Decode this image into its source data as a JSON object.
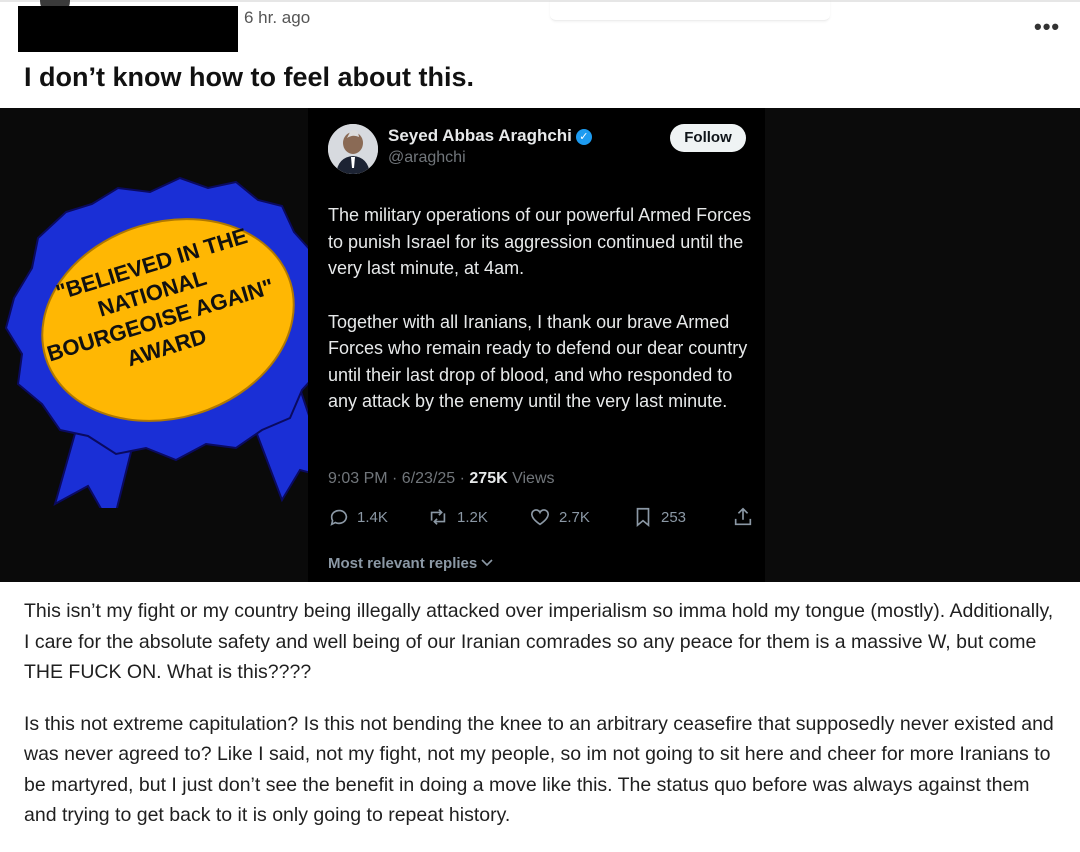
{
  "post": {
    "time": "6 hr. ago",
    "more_label": "•••",
    "title": "I don’t know how to feel about this.",
    "body": [
      "This isn’t my fight or my country being illegally attacked over imperialism so imma hold my tongue (mostly). Additionally, I care for the absolute safety and well being of our Iranian comrades so any peace for them is a massive W, but come THE FUCK ON. What is this????",
      "Is this not extreme capitulation? Is this not bending the knee to an arbitrary ceasefire that supposedly never existed and was never agreed to? Like I said, not my fight, not my people, so im not going to sit here and cheer for more Iranians to be martyred, but I just don’t see the benefit in doing a move like this. The status quo before was always against them and trying to get back to it is only going to repeat history."
    ]
  },
  "award": {
    "lines": [
      "\"BELIEVED IN THE",
      "NATIONAL",
      "BOURGEOISE AGAIN\"",
      "AWARD"
    ],
    "ribbon_color": "#1a2fd6",
    "badge_color": "#ffb703"
  },
  "tweet": {
    "name": "Seyed Abbas Araghchi",
    "handle": "@araghchi",
    "follow_label": "Follow",
    "body": [
      "The military operations of our powerful Armed Forces to punish Israel for its aggression continued until the very last minute, at 4am.",
      "Together with all Iranians, I thank our brave Armed Forces who remain ready to defend our dear country until their last drop of blood, and who responded to any attack by the enemy until the very last minute."
    ],
    "meta_time": "9:03 PM · 6/23/25 · ",
    "meta_views_count": "275K",
    "meta_views_label": " Views",
    "replies_count": "1.4K",
    "reposts_count": "1.2K",
    "likes_count": "2.7K",
    "bookmarks_count": "253",
    "replies_label": "Most relevant replies",
    "colors": {
      "background": "#000000",
      "text": "#e7e9ea",
      "muted": "#71767b",
      "verified": "#1d9bf0"
    }
  }
}
